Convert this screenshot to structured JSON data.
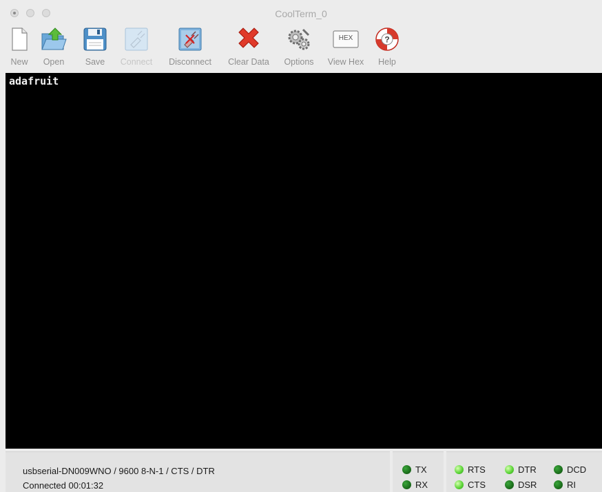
{
  "window": {
    "title": "CoolTerm_0"
  },
  "toolbar": {
    "items": [
      {
        "label": "New",
        "icon": "new-document-icon",
        "enabled": true
      },
      {
        "label": "Open",
        "icon": "open-folder-icon",
        "enabled": true
      },
      {
        "label": "Save",
        "icon": "floppy-disk-icon",
        "enabled": true
      },
      {
        "label": "Connect",
        "icon": "connect-plug-icon",
        "enabled": false
      },
      {
        "label": "Disconnect",
        "icon": "disconnect-plug-icon",
        "enabled": true
      },
      {
        "label": "Clear Data",
        "icon": "red-x-icon",
        "enabled": true
      },
      {
        "label": "Options",
        "icon": "gears-icon",
        "enabled": true
      },
      {
        "label": "View Hex",
        "icon": "hex-icon",
        "enabled": true,
        "icon_text": "HEX"
      },
      {
        "label": "Help",
        "icon": "lifebuoy-help-icon",
        "enabled": true
      }
    ]
  },
  "terminal": {
    "content": "adafruit"
  },
  "status": {
    "port_settings": "usbserial-DN009WNO / 9600 8-N-1 / CTS / DTR",
    "connection": "Connected 00:01:32"
  },
  "indicators": {
    "tx": "TX",
    "rx": "RX",
    "rts": "RTS",
    "cts": "CTS",
    "dtr": "DTR",
    "dsr": "DSR",
    "dcd": "DCD",
    "ri": "RI"
  },
  "colors": {
    "terminal_bg": "#000000",
    "terminal_fg": "#f2f2f2",
    "led_on": "#5fd63a",
    "led_off": "#1c6f1c"
  }
}
